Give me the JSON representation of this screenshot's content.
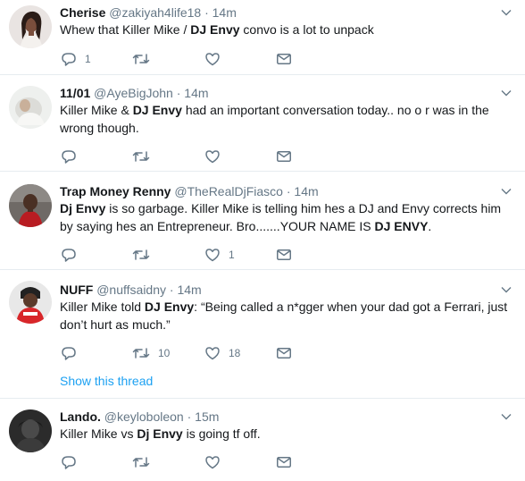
{
  "tweets": [
    {
      "name": "Cherise",
      "handle": "@zakiyah4life18",
      "separator": "·",
      "time": "14m",
      "text": [
        {
          "t": "Whew that Killer Mike / ",
          "b": false
        },
        {
          "t": "DJ Envy",
          "b": true
        },
        {
          "t": " convo is a lot to unpack",
          "b": false
        }
      ],
      "reply_count": "1",
      "retweet_count": "",
      "like_count": ""
    },
    {
      "name": "11/01",
      "handle": "@AyeBigJohn",
      "separator": "·",
      "time": "14m",
      "text": [
        {
          "t": "Killer Mike & ",
          "b": false
        },
        {
          "t": "DJ Envy",
          "b": true
        },
        {
          "t": " had an important conversation today.. no o r was in the wrong though.",
          "b": false
        }
      ],
      "reply_count": "",
      "retweet_count": "",
      "like_count": ""
    },
    {
      "name": "Trap Money Renny",
      "handle": "@TheRealDjFiasco",
      "separator": "·",
      "time": "14m",
      "text": [
        {
          "t": "Dj Envy",
          "b": true
        },
        {
          "t": " is so garbage. Killer Mike is telling him hes a DJ and Envy corrects him by saying hes an Entrepreneur. Bro.......YOUR NAME IS ",
          "b": false
        },
        {
          "t": "DJ ENVY",
          "b": true
        },
        {
          "t": ".",
          "b": false
        }
      ],
      "reply_count": "",
      "retweet_count": "",
      "like_count": "1"
    },
    {
      "name": "NUFF",
      "handle": "@nuffsaidny",
      "separator": "·",
      "time": "14m",
      "text": [
        {
          "t": "Killer Mike told ",
          "b": false
        },
        {
          "t": "DJ Envy",
          "b": true
        },
        {
          "t": ": “Being called a n*gger when your dad got a Ferrari, just don’t hurt as much.”",
          "b": false
        }
      ],
      "reply_count": "",
      "retweet_count": "10",
      "like_count": "18",
      "show_thread": "Show this thread"
    },
    {
      "name": "Lando.",
      "handle": "@keyloboleon",
      "separator": "·",
      "time": "15m",
      "text": [
        {
          "t": "Killer Mike vs ",
          "b": false
        },
        {
          "t": "Dj Envy",
          "b": true
        },
        {
          "t": " is going tf off.",
          "b": false
        }
      ],
      "reply_count": "",
      "retweet_count": "",
      "like_count": ""
    }
  ],
  "icons": {
    "reply": "reply-icon",
    "retweet": "retweet-icon",
    "like": "heart-icon",
    "dm": "envelope-icon",
    "caret": "chevron-down-icon"
  },
  "colors": {
    "text": "#14171a",
    "muted": "#657786",
    "link": "#1da1f2",
    "divider": "#e6ecf0"
  }
}
